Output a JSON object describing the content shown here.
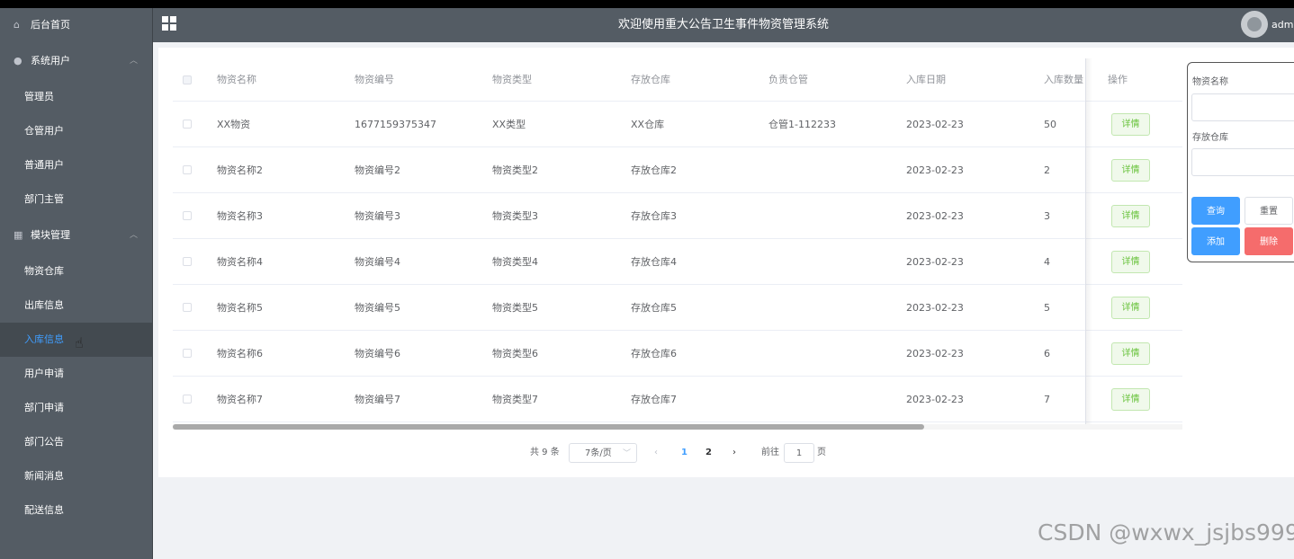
{
  "sidebar": {
    "home": "后台首页",
    "group_users": "系统用户",
    "admin": "管理员",
    "warehouse_user": "仓管用户",
    "normal_user": "普通用户",
    "dept_head": "部门主管",
    "group_modules": "模块管理",
    "material_warehouse": "物资仓库",
    "outbound": "出库信息",
    "inbound": "入库信息",
    "user_apply": "用户申请",
    "dept_apply": "部门申请",
    "dept_notice": "部门公告",
    "news": "新闻消息",
    "delivery": "配送信息"
  },
  "header": {
    "title": "欢迎使用重大公告卫生事件物资管理系统",
    "username": "admi"
  },
  "table": {
    "columns": [
      "物资名称",
      "物资编号",
      "物资类型",
      "存放仓库",
      "负责仓管",
      "入库日期",
      "入库数量",
      "操作"
    ],
    "detail_label": "详情",
    "rows": [
      [
        "XX物资",
        "1677159375347",
        "XX类型",
        "XX仓库",
        "仓管1-112233",
        "2023-02-23",
        "50"
      ],
      [
        "物资名称2",
        "物资编号2",
        "物资类型2",
        "存放仓库2",
        "",
        "2023-02-23",
        "2"
      ],
      [
        "物资名称3",
        "物资编号3",
        "物资类型3",
        "存放仓库3",
        "",
        "2023-02-23",
        "3"
      ],
      [
        "物资名称4",
        "物资编号4",
        "物资类型4",
        "存放仓库4",
        "",
        "2023-02-23",
        "4"
      ],
      [
        "物资名称5",
        "物资编号5",
        "物资类型5",
        "存放仓库5",
        "",
        "2023-02-23",
        "5"
      ],
      [
        "物资名称6",
        "物资编号6",
        "物资类型6",
        "存放仓库6",
        "",
        "2023-02-23",
        "6"
      ],
      [
        "物资名称7",
        "物资编号7",
        "物资类型7",
        "存放仓库7",
        "",
        "2023-02-23",
        "7"
      ]
    ]
  },
  "pager": {
    "total": "共 9 条",
    "page_size": "7条/页",
    "prev": "‹",
    "pages": [
      "1",
      "2"
    ],
    "next": "›",
    "goto": "前往",
    "current": "1",
    "page_suffix": "页"
  },
  "search": {
    "name_label": "物资名称",
    "warehouse_label": "存放仓库",
    "query": "查询",
    "reset": "重置",
    "add": "添加",
    "delete": "删除"
  },
  "watermark": "CSDN @wxwx_jsjbs999",
  "colors": {
    "sidebar_bg": "#545c64",
    "primary": "#409eff",
    "success": "#67c23a",
    "danger": "#f56c6c"
  }
}
